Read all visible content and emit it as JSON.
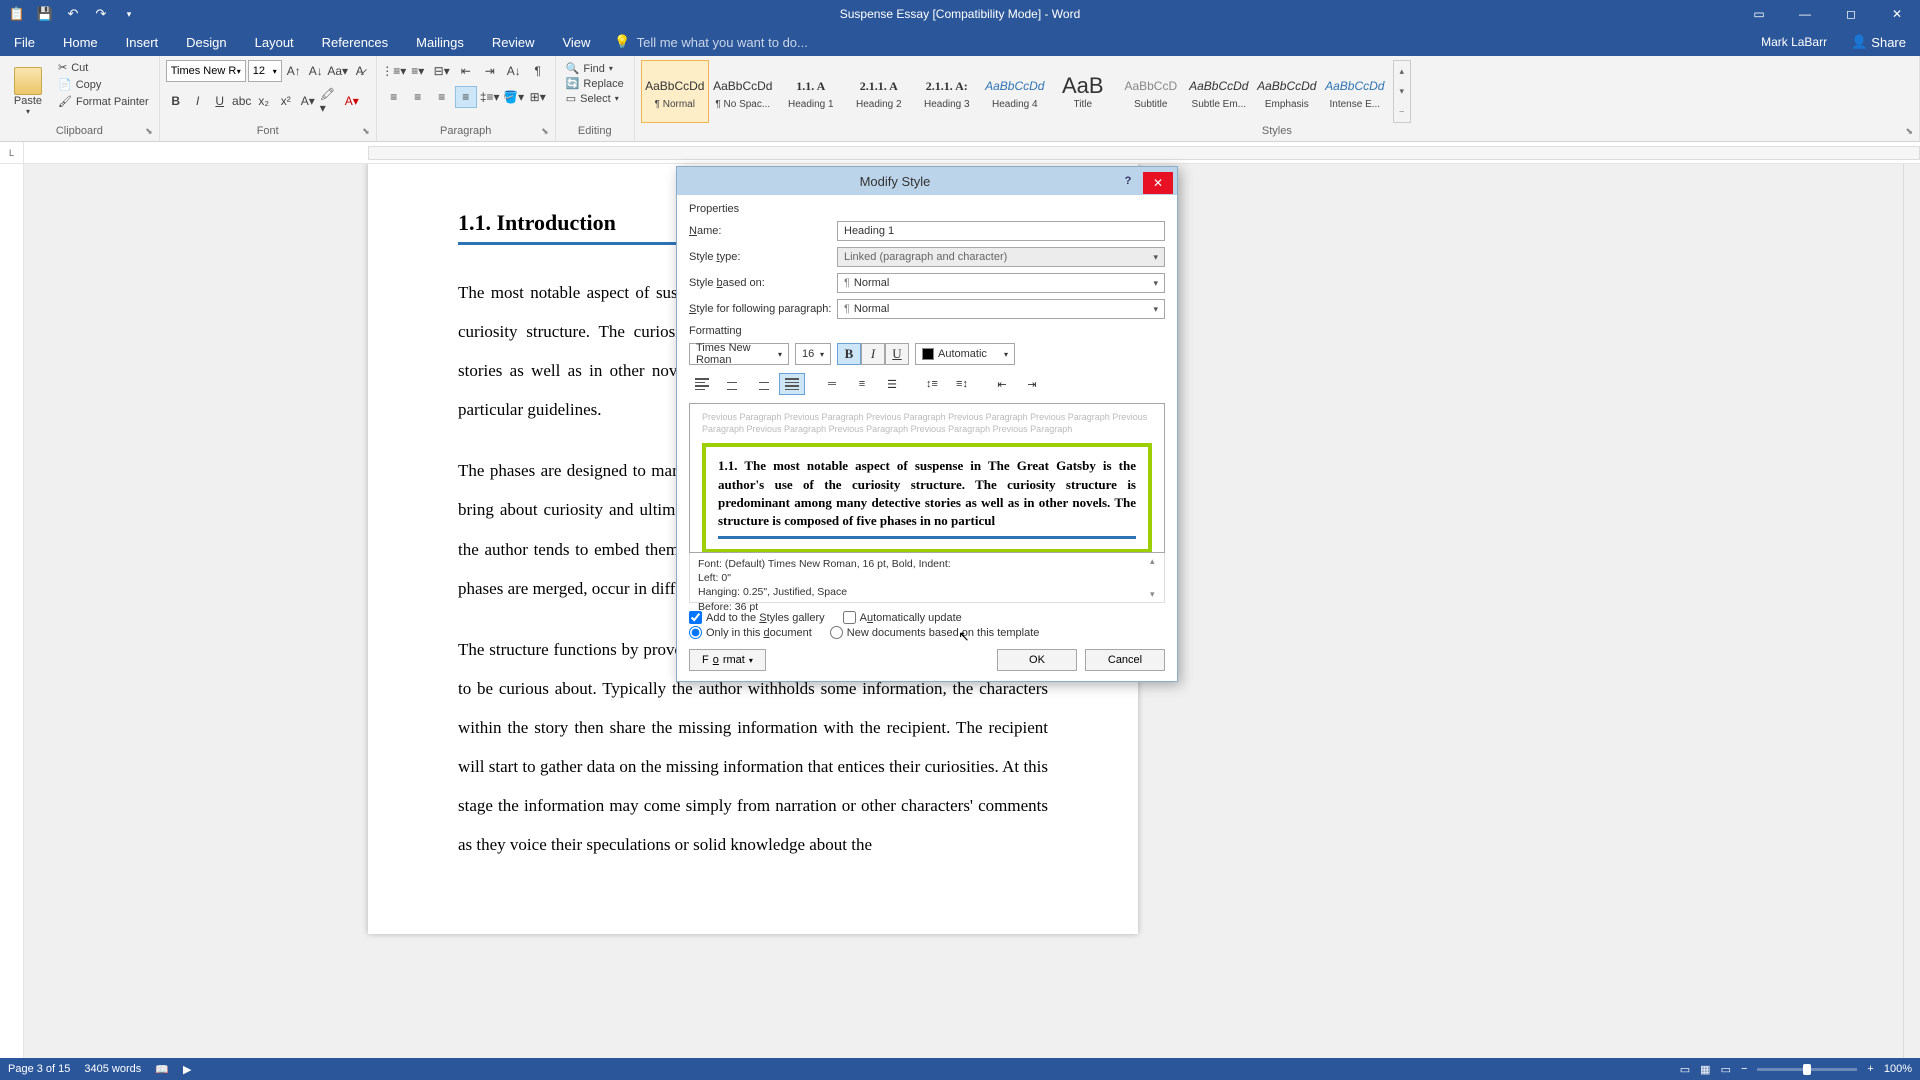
{
  "titlebar": {
    "title": "Suspense Essay [Compatibility Mode] - Word"
  },
  "ribbonTabs": {
    "file": "File",
    "tabs": [
      "Home",
      "Insert",
      "Design",
      "Layout",
      "References",
      "Mailings",
      "Review",
      "View"
    ],
    "tellme": "Tell me what you want to do...",
    "user": "Mark LaBarr",
    "share": "Share"
  },
  "clipboard": {
    "paste": "Paste",
    "cut": "Cut",
    "copy": "Copy",
    "formatPainter": "Format Painter",
    "label": "Clipboard"
  },
  "font": {
    "name": "Times New R",
    "size": "12",
    "label": "Font"
  },
  "paragraph": {
    "label": "Paragraph"
  },
  "editing": {
    "find": "Find",
    "replace": "Replace",
    "select": "Select",
    "label": "Editing"
  },
  "styles": {
    "label": "Styles",
    "items": [
      {
        "preview": "AaBbCcDd",
        "name": "¶ Normal",
        "active": true
      },
      {
        "preview": "AaBbCcDd",
        "name": "¶ No Spac..."
      },
      {
        "preview": "1.1. A",
        "name": "Heading 1"
      },
      {
        "preview": "2.1.1. A",
        "name": "Heading 2"
      },
      {
        "preview": "2.1.1. A:",
        "name": "Heading 3"
      },
      {
        "preview": "AaBbCcDd",
        "name": "Heading 4"
      },
      {
        "preview": "AaB",
        "name": "Title"
      },
      {
        "preview": "AaBbCcD",
        "name": "Subtitle"
      },
      {
        "preview": "AaBbCcDd",
        "name": "Subtle Em..."
      },
      {
        "preview": "AaBbCcDd",
        "name": "Emphasis"
      },
      {
        "preview": "AaBbCcDd",
        "name": "Intense E..."
      }
    ]
  },
  "document": {
    "heading": "1.1.   Introduction",
    "p1": "The most notable aspect of suspense in The Great Gatsby is the author's use of the curiosity structure. The curiosity structure is predominant among many detective stories as well as in other novels. The structure is composed of five phases in no particular guidelines.",
    "p2": "The phases are designed to mark distinct stages in the reading process in an effort to bring about curiosity and ultimately suspense. Due to the fluid nature of the phases, the author tends to embed them several times in the novel as a whole. Generally the phases are merged, occur in differing orders, or even be omitted from the novel.",
    "p3": "The structure functions by provoking curiosity by allowing readers to have something to be curious about. Typically the author withholds some information, the characters within the story then share the missing information with the recipient. The recipient will start to gather data on the missing information that entices their curiosities. At this stage the information may come simply from narration or other characters' comments as they voice their speculations or solid knowledge about the"
  },
  "dialog": {
    "title": "Modify Style",
    "properties": "Properties",
    "name": {
      "label": "Name:",
      "value": "Heading 1"
    },
    "styleType": {
      "label": "Style type:",
      "value": "Linked (paragraph and character)"
    },
    "basedOn": {
      "label": "Style based on:",
      "value": "Normal"
    },
    "following": {
      "label": "Style for following paragraph:",
      "value": "Normal"
    },
    "formatting": "Formatting",
    "fontName": "Times New Roman",
    "fontSize": "16",
    "colorAuto": "Automatic",
    "previewPrev": "Previous Paragraph Previous Paragraph Previous Paragraph Previous Paragraph Previous Paragraph Previous Paragraph Previous Paragraph Previous Paragraph Previous Paragraph Previous Paragraph",
    "previewSample": "1.1.  The most notable aspect of suspense in The Great Gatsby is the author's use of the curiosity structure. The curiosity structure is predominant among many detective stories as well as in other novels. The structure is composed of five phases in no particul",
    "desc": {
      "l1": "Font: (Default) Times New Roman, 16 pt, Bold, Indent:",
      "l2": "    Left:  0\"",
      "l3": "    Hanging:  0.25\", Justified, Space",
      "l4": "    Before:  36 pt"
    },
    "addToGallery": "Add to the Styles gallery",
    "autoUpdate": "Automatically update",
    "onlyDoc": "Only in this document",
    "newDocs": "New documents based on this template",
    "format": "Format",
    "ok": "OK",
    "cancel": "Cancel"
  },
  "statusbar": {
    "page": "Page 3 of 15",
    "words": "3405 words",
    "zoom": "100%"
  }
}
